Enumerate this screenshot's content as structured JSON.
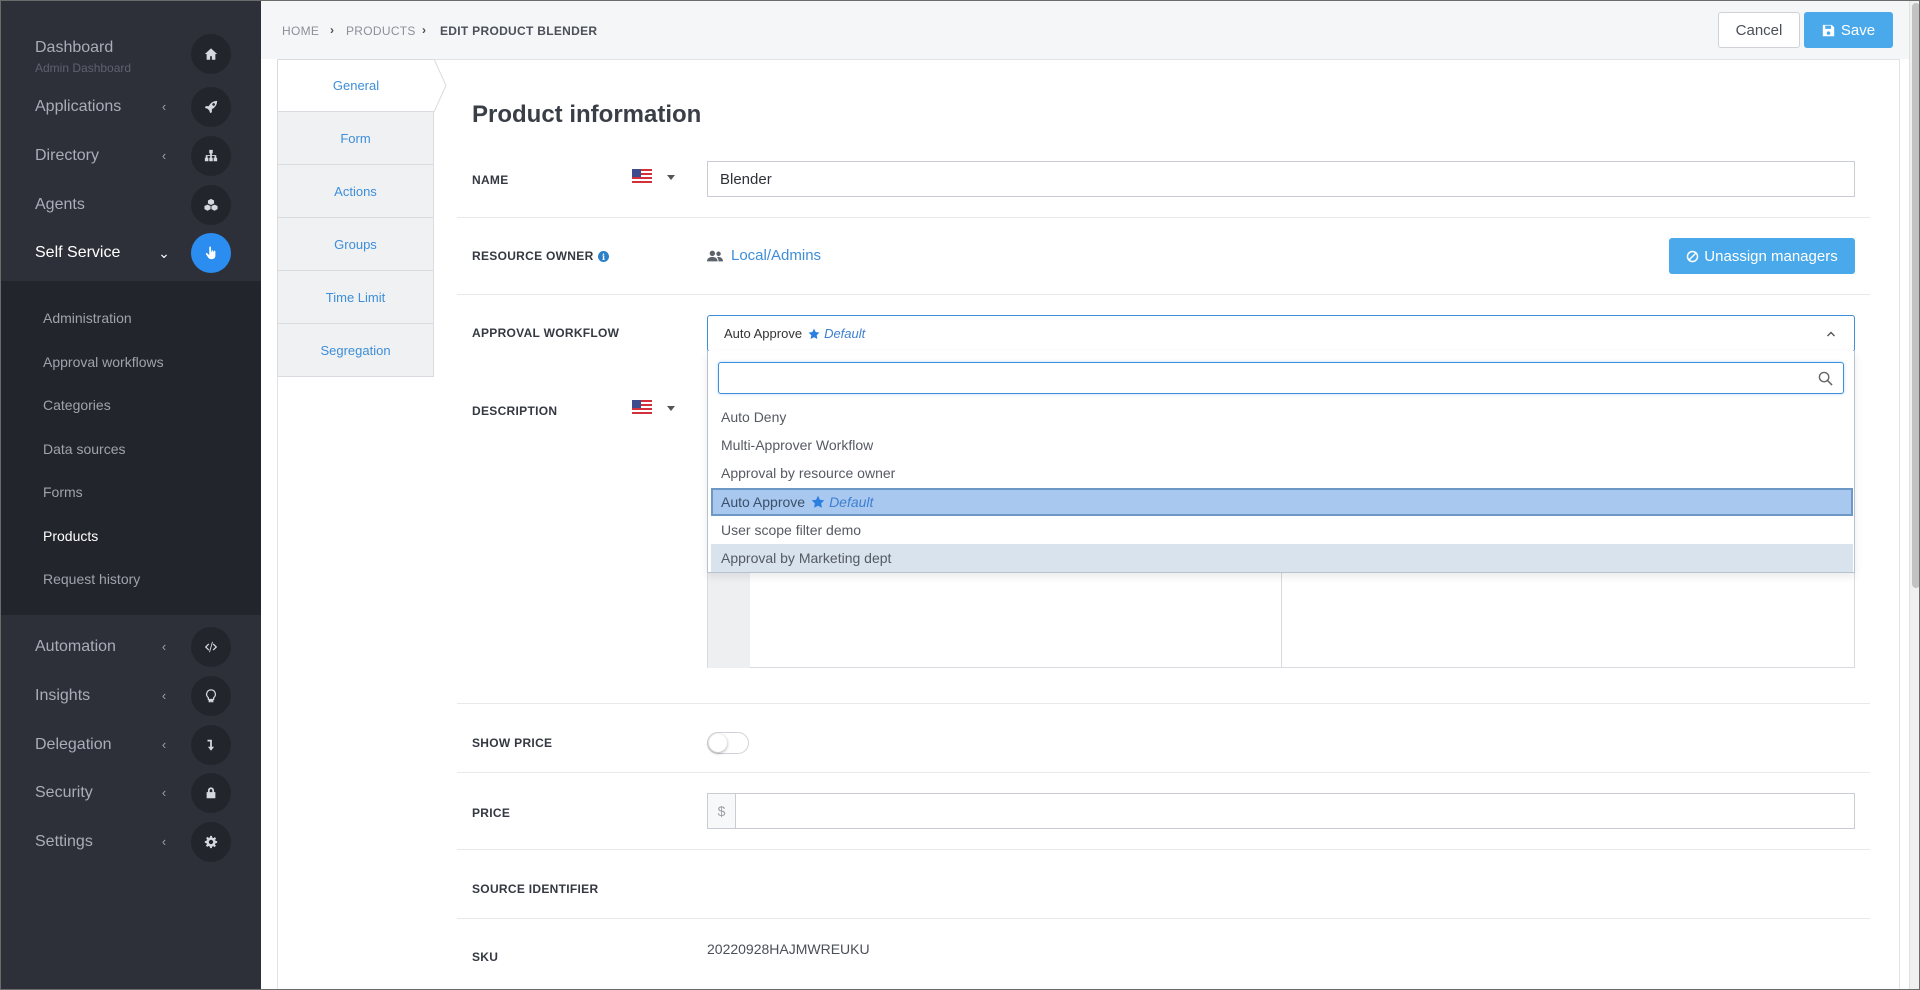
{
  "sidebar": {
    "items": [
      {
        "label": "Dashboard",
        "sublabel": "Admin Dashboard",
        "icon": "home-icon"
      },
      {
        "label": "Applications",
        "icon": "rocket-icon"
      },
      {
        "label": "Directory",
        "icon": "sitemap-icon"
      },
      {
        "label": "Agents",
        "icon": "cubes-icon"
      },
      {
        "label": "Self Service",
        "icon": "hand-pointer-icon",
        "active": true
      },
      {
        "label": "Automation",
        "icon": "code-icon"
      },
      {
        "label": "Insights",
        "icon": "lightbulb-icon"
      },
      {
        "label": "Delegation",
        "icon": "level-down-icon"
      },
      {
        "label": "Security",
        "icon": "lock-icon"
      },
      {
        "label": "Settings",
        "icon": "gear-icon"
      }
    ],
    "submenu": [
      "Administration",
      "Approval workflows",
      "Categories",
      "Data sources",
      "Forms",
      "Products",
      "Request history"
    ],
    "submenu_active": "Products"
  },
  "breadcrumb": {
    "items": [
      "HOME",
      "PRODUCTS",
      "EDIT PRODUCT BLENDER"
    ]
  },
  "toolbar": {
    "cancel_label": "Cancel",
    "save_label": "Save"
  },
  "tabs": [
    "General",
    "Form",
    "Actions",
    "Groups",
    "Time Limit",
    "Segregation"
  ],
  "active_tab": "General",
  "form": {
    "heading": "Product information",
    "name_label": "NAME",
    "name_value": "Blender",
    "owner_label": "RESOURCE OWNER",
    "owner_value": "Local/Admins",
    "unassign_label": "Unassign managers",
    "approval_label": "APPROVAL WORKFLOW",
    "approval_value": "Auto Approve",
    "default_tag": "Default",
    "description_label": "DESCRIPTION",
    "show_price_label": "SHOW PRICE",
    "show_price_on": false,
    "price_label": "PRICE",
    "currency": "$",
    "source_identifier_label": "SOURCE IDENTIFIER",
    "sku_label": "SKU",
    "sku_value": "20220928HAJMWREUKU"
  },
  "dropdown": {
    "search_placeholder": "",
    "options": [
      {
        "label": "Auto Deny"
      },
      {
        "label": "Multi-Approver Workflow"
      },
      {
        "label": "Approval by resource owner"
      },
      {
        "label": "Auto Approve",
        "default": true,
        "selected": true
      },
      {
        "label": "User scope filter demo"
      },
      {
        "label": "Approval by Marketing dept",
        "hover": true
      }
    ]
  },
  "colors": {
    "accent": "#4aa9ea",
    "link": "#3e8ed8",
    "sidebar_bg": "#2d3039",
    "active_icon_bg": "#2b8df0"
  }
}
